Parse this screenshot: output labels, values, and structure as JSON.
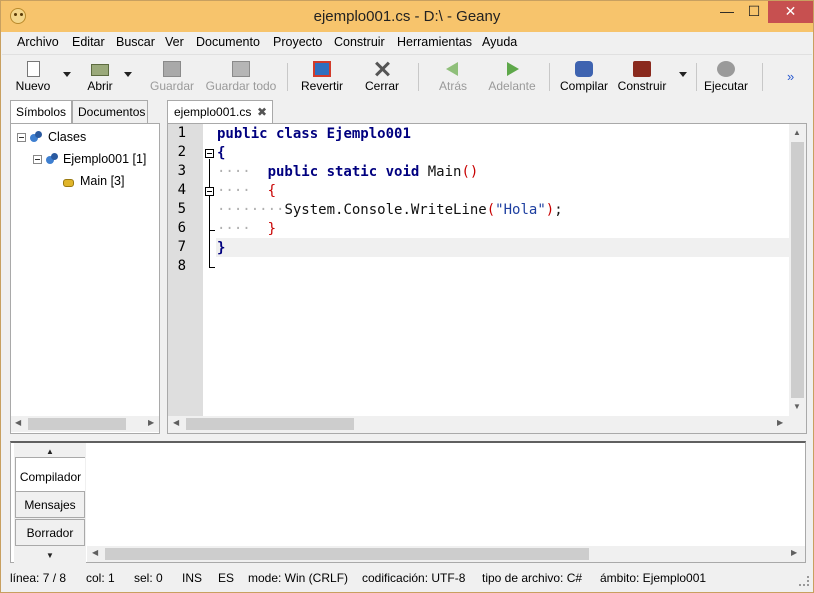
{
  "window": {
    "title": "ejemplo001.cs - D:\\ - Geany",
    "min_label": "—",
    "max_label": "☐",
    "close_label": "✕"
  },
  "menu": [
    "Archivo",
    "Editar",
    "Buscar",
    "Ver",
    "Documento",
    "Proyecto",
    "Construir",
    "Herramientas",
    "Ayuda"
  ],
  "toolbar": {
    "new": "Nuevo",
    "open": "Abrir",
    "save": "Guardar",
    "save_all": "Guardar todo",
    "revert": "Revertir",
    "close": "Cerrar",
    "back": "Atrás",
    "forward": "Adelante",
    "compile": "Compilar",
    "build": "Construir",
    "run": "Ejecutar",
    "more": "»"
  },
  "sidebar": {
    "tabs": [
      "Símbolos",
      "Documentos"
    ],
    "tree": [
      {
        "label": "Clases"
      },
      {
        "label": "Ejemplo001 [1]"
      },
      {
        "label": "Main [3]"
      }
    ]
  },
  "editor": {
    "tab_label": "ejemplo001.cs",
    "tab_close": "✖",
    "line_numbers": [
      "1",
      "2",
      "3",
      "4",
      "5",
      "6",
      "7",
      "8"
    ],
    "code": {
      "l1_kw": "public class",
      "l1_name": "Ejemplo001",
      "l2": "{",
      "l3_dots": "····",
      "l3_kw": "public static void",
      "l3_name": "Main",
      "l3_parens": "()",
      "l4_dots": "····",
      "l4": "{",
      "l5_dots": "········",
      "l5_call": "System.Console.WriteLine",
      "l5_open": "(",
      "l5_str": "\"Hola\"",
      "l5_close": ")",
      "l5_semi": ";",
      "l6_dots": "····",
      "l6": "}",
      "l7": "}"
    }
  },
  "messages": {
    "tabs": [
      "Compilador",
      "Mensajes",
      "Borrador"
    ],
    "up_arrow": "▲",
    "down_arrow": "▼"
  },
  "statusbar": {
    "line": "línea: 7 / 8",
    "col": "col: 1",
    "sel": "sel: 0",
    "ins": "INS",
    "tab": "ES",
    "mode": "mode: Win (CRLF)",
    "encoding": "codificación: UTF-8",
    "filetype": "tipo de archivo: C#",
    "scope": "ámbito: Ejemplo001"
  },
  "colors": {
    "titlebar": "#f7c46c",
    "keyword": "#00007f",
    "brace_inner": "#c80000",
    "string": "#1e3fa0",
    "gutter": "#dedede"
  }
}
